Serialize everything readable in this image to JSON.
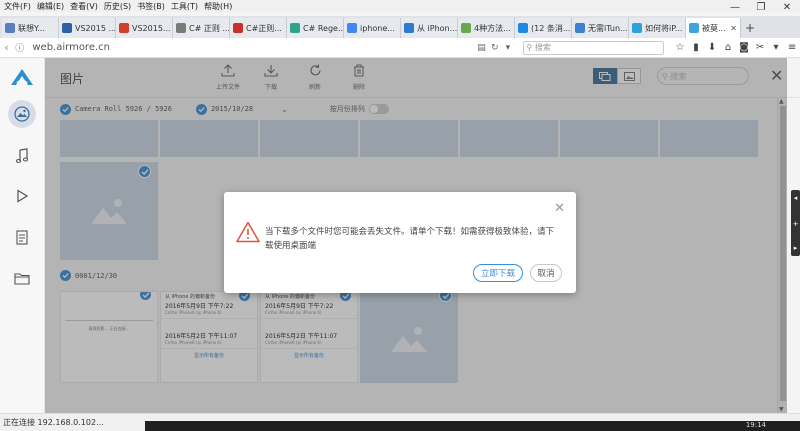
{
  "window": {
    "minimize": "—",
    "restore": "❐",
    "close": "✕"
  },
  "menu": [
    "文件(F)",
    "编辑(E)",
    "查看(V)",
    "历史(S)",
    "书签(B)",
    "工具(T)",
    "帮助(H)"
  ],
  "tabs": [
    {
      "label": "联想Y...",
      "color": "#5a7fbf"
    },
    {
      "label": "VS2015 ...",
      "color": "#2d5fa8"
    },
    {
      "label": "VS2015...",
      "color": "#d43c2c"
    },
    {
      "label": "C# 正则 ...",
      "color": "#7a7a7a"
    },
    {
      "label": "C#正则...",
      "color": "#c9302c"
    },
    {
      "label": "C# Rege...",
      "color": "#2ea389"
    },
    {
      "label": "iphone...",
      "color": "#4285f4"
    },
    {
      "label": "从 iPhon...",
      "color": "#2b7bd0"
    },
    {
      "label": "4种方法...",
      "color": "#6aa84f"
    },
    {
      "label": "(12 条消...",
      "color": "#1e88e5"
    },
    {
      "label": "无需iTun...",
      "color": "#3d7fd1"
    },
    {
      "label": "如何将iP...",
      "color": "#2ba2d9"
    },
    {
      "label": "被莫...",
      "color": "#3aa6e0",
      "active": true
    }
  ],
  "address": {
    "url": "web.airmore.cn",
    "search_placeholder": "搜索"
  },
  "header": {
    "title": "图片",
    "tools": [
      {
        "label": "上传文件",
        "icon": "upload-icon"
      },
      {
        "label": "下载",
        "icon": "download-icon"
      },
      {
        "label": "刷新",
        "icon": "refresh-icon"
      },
      {
        "label": "删除",
        "icon": "delete-icon"
      }
    ],
    "search_placeholder": "搜索"
  },
  "filters": {
    "album": "Camera Roll  5926 / 5926",
    "date": "2015/10/28",
    "sort_by_year": "按月份排列"
  },
  "section2_date": "0001/12/30",
  "screenshots": [
    {
      "title": "从 iPhone 的偏新备份",
      "entries": [
        {
          "date": "2016年5月9日 下午7:22",
          "device": "CnYan iPhone6 (从 iPhone 6)"
        },
        {
          "date": "2016年5月2日 下午11:07",
          "device": "CnYan iPhone6 (从 iPhone 6)"
        }
      ],
      "link": "显示所有备份"
    },
    {
      "title": "从 iPhone 的偏新备份",
      "entries": [
        {
          "date": "2016年5月9日 下午7:22",
          "device": "CnYan iPhone6 (从 iPhone 6)"
        },
        {
          "date": "2016年5月2日 下午11:07",
          "device": "CnYan iPhone6 (从 iPhone 6)"
        }
      ],
      "link": "显示所有备份"
    }
  ],
  "first_shot_caption": "离线投影... 正在连接...",
  "dialog": {
    "message": "当下载多个文件时您可能会丢失文件。请单个下载！如需获得极致体验，请下载使用桌面端",
    "primary": "立即下载",
    "cancel": "取消"
  },
  "status": {
    "text": "正在连接 192.168.0.102...",
    "clock": "19:14"
  },
  "colors": {
    "accent": "#3a8ed8",
    "thumb": "#c9d6e3",
    "warning": "#e0533c"
  }
}
